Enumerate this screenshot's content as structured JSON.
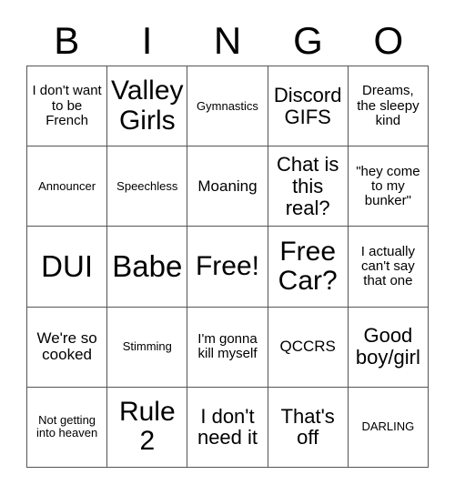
{
  "card": {
    "title": "BINGO",
    "header_letters": [
      "B",
      "I",
      "N",
      "G",
      "O"
    ],
    "grid_size": "5x5",
    "border_color": "#555555",
    "background_color": "#ffffff",
    "text_color": "#000000",
    "free_space_label": "Free!",
    "free_space_position": "row3-col3"
  },
  "cells": [
    {
      "row": 1,
      "col": 1,
      "letter": "B",
      "text": "I don't want to be French",
      "size": "xs"
    },
    {
      "row": 1,
      "col": 2,
      "letter": "I",
      "text": "Valley Girls",
      "size": "xl"
    },
    {
      "row": 1,
      "col": 3,
      "letter": "N",
      "text": "Gymnastics",
      "size": "xxs"
    },
    {
      "row": 1,
      "col": 4,
      "letter": "G",
      "text": "Discord GIFS",
      "size": "md"
    },
    {
      "row": 1,
      "col": 5,
      "letter": "O",
      "text": "Dreams, the sleepy kind",
      "size": "xs"
    },
    {
      "row": 2,
      "col": 1,
      "letter": "B",
      "text": "Announcer",
      "size": "xxs"
    },
    {
      "row": 2,
      "col": 2,
      "letter": "I",
      "text": "Speechless",
      "size": "xxs"
    },
    {
      "row": 2,
      "col": 3,
      "letter": "N",
      "text": "Moaning",
      "size": "sm"
    },
    {
      "row": 2,
      "col": 4,
      "letter": "G",
      "text": "Chat is this real?",
      "size": "md"
    },
    {
      "row": 2,
      "col": 5,
      "letter": "O",
      "text": "\"hey come to my bunker\"",
      "size": "xs"
    },
    {
      "row": 3,
      "col": 1,
      "letter": "B",
      "text": "DUI",
      "size": "xxl"
    },
    {
      "row": 3,
      "col": 2,
      "letter": "I",
      "text": "Babe",
      "size": "xxl"
    },
    {
      "row": 3,
      "col": 3,
      "letter": "N",
      "text": "Free!",
      "size": "xl"
    },
    {
      "row": 3,
      "col": 4,
      "letter": "G",
      "text": "Free Car?",
      "size": "xl"
    },
    {
      "row": 3,
      "col": 5,
      "letter": "O",
      "text": "I actually can't say that one",
      "size": "xs"
    },
    {
      "row": 4,
      "col": 1,
      "letter": "B",
      "text": "We're so cooked",
      "size": "sm"
    },
    {
      "row": 4,
      "col": 2,
      "letter": "I",
      "text": "Stimming",
      "size": "xxs"
    },
    {
      "row": 4,
      "col": 3,
      "letter": "N",
      "text": "I'm gonna kill myself",
      "size": "xs"
    },
    {
      "row": 4,
      "col": 4,
      "letter": "G",
      "text": "QCCRS",
      "size": "sm"
    },
    {
      "row": 4,
      "col": 5,
      "letter": "O",
      "text": "Good boy/girl",
      "size": "md"
    },
    {
      "row": 5,
      "col": 1,
      "letter": "B",
      "text": "Not getting into heaven",
      "size": "xxs"
    },
    {
      "row": 5,
      "col": 2,
      "letter": "I",
      "text": "Rule 2",
      "size": "xl"
    },
    {
      "row": 5,
      "col": 3,
      "letter": "N",
      "text": "I don't need it",
      "size": "md"
    },
    {
      "row": 5,
      "col": 4,
      "letter": "G",
      "text": "That's off",
      "size": "md"
    },
    {
      "row": 5,
      "col": 5,
      "letter": "O",
      "text": "DARLING",
      "size": "xxs"
    }
  ]
}
